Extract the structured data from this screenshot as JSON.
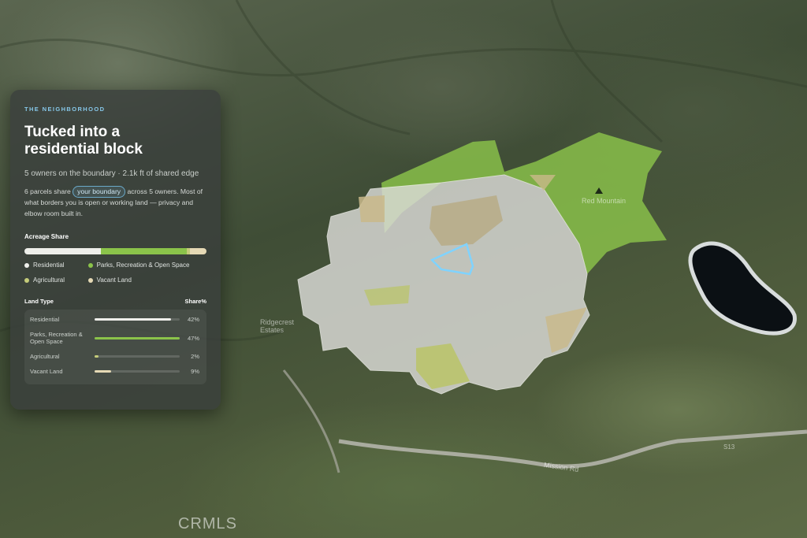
{
  "panel": {
    "eyebrow": "THE NEIGHBORHOOD",
    "title": "Tucked into a residential block",
    "subtitle": "5 owners on the boundary · 2.1k ft of shared edge",
    "desc_before": "6 parcels share ",
    "desc_pill": "your boundary",
    "desc_after": " across 5 owners. Most of what borders you is open or working land — privacy and elbow room built in.",
    "acreage_label": "Acreage Share",
    "land_type_label": "Land Type",
    "share_label": "Share%",
    "categories": [
      {
        "name": "Residential",
        "legend": "Residential",
        "share": 42,
        "pct_text": "42%",
        "color": "#eeeeea"
      },
      {
        "name": "Parks, Recreation & Open Space",
        "legend": "Parks, Recreation & Open Space",
        "share": 47,
        "pct_text": "47%",
        "color": "#8bc34a"
      },
      {
        "name": "Agricultural",
        "legend": "Agricultural",
        "share": 2,
        "pct_text": "2%",
        "color": "#c5cc7a"
      },
      {
        "name": "Vacant Land",
        "legend": "Vacant Land",
        "share": 9,
        "pct_text": "9%",
        "color": "#e5d9b5"
      }
    ]
  },
  "map": {
    "place_label": "Ridgecrest Estates",
    "road_label": "Mission Rd",
    "peak_label": "Red Mountain",
    "route_label": "S13",
    "watermark": "CRMLS",
    "colors": {
      "parks": "#8bc34a",
      "residential": "#d8d8d4",
      "vacant": "#c9b98a",
      "agricultural": "#b9c46a",
      "subject_outline": "#7fd3ff",
      "water": "#0b1014"
    }
  }
}
